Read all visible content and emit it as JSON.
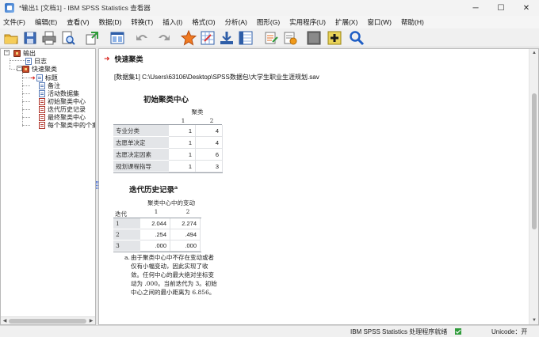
{
  "window": {
    "title": "*输出1 [文档1] - IBM SPSS Statistics 查看器",
    "minimize": "─",
    "maximize": "☐",
    "close": "✕"
  },
  "menu": [
    "文件(F)",
    "编辑(E)",
    "查看(V)",
    "数据(D)",
    "转换(T)",
    "插入(I)",
    "格式(O)",
    "分析(A)",
    "图形(G)",
    "实用程序(U)",
    "扩展(X)",
    "窗口(W)",
    "帮助(H)"
  ],
  "toolbar_icons": [
    "open-icon",
    "save-icon",
    "print-icon",
    "print-preview-icon",
    "export-icon",
    "recall-dialog-icon",
    "undo-icon",
    "redo-icon",
    "goto-data-icon",
    "goto-case-icon",
    "goto-variable-icon",
    "variables-icon",
    "create-title-icon",
    "insert-table-icon",
    "show-hide-icon",
    "add-output-icon",
    "search-icon"
  ],
  "tree": {
    "root": "输出",
    "log": "日志",
    "procedure": "快速聚类",
    "children": [
      "标题",
      "备注",
      "活动数据集",
      "初始聚类中心",
      "迭代历史记录",
      "最终聚类中心",
      "每个聚类中的个案"
    ]
  },
  "output": {
    "section_title": "快速聚类",
    "dataset_line": "[数据集1] C:\\Users\\63106\\Desktop\\SPSS数据包\\大学生职业生涯规划.sav",
    "initial_centers": {
      "title": "初始聚类中心",
      "group_header": "聚类",
      "columns": [
        "1",
        "2"
      ],
      "rows": [
        {
          "label": "专业分类",
          "values": [
            "1",
            "4"
          ]
        },
        {
          "label": "志愿单决定",
          "values": [
            "1",
            "4"
          ]
        },
        {
          "label": "志愿决定因素",
          "values": [
            "1",
            "6"
          ]
        },
        {
          "label": "规划课程指导",
          "values": [
            "1",
            "3"
          ]
        }
      ]
    },
    "iteration_history": {
      "title": "迭代历史记录",
      "superscript": "a",
      "group_header": "聚类中心中的变动",
      "row_header": "迭代",
      "columns": [
        "1",
        "2"
      ],
      "rows": [
        {
          "label": "1",
          "values": [
            "2.044",
            "2.274"
          ]
        },
        {
          "label": "2",
          "values": [
            ".254",
            ".494"
          ]
        },
        {
          "label": "3",
          "values": [
            ".000",
            ".000"
          ]
        }
      ],
      "footnote_marker": "a.",
      "footnote": "由于聚类中心中不存在变动或者仅有小幅变动，因此实现了收敛。任何中心的最大绝对坐标变动为 .000。当前迭代为 3。初始中心之间的最小距离为 6.856。"
    }
  },
  "status": {
    "message": "IBM SPSS Statistics 处理程序就绪",
    "unicode": "Unicode：开"
  }
}
